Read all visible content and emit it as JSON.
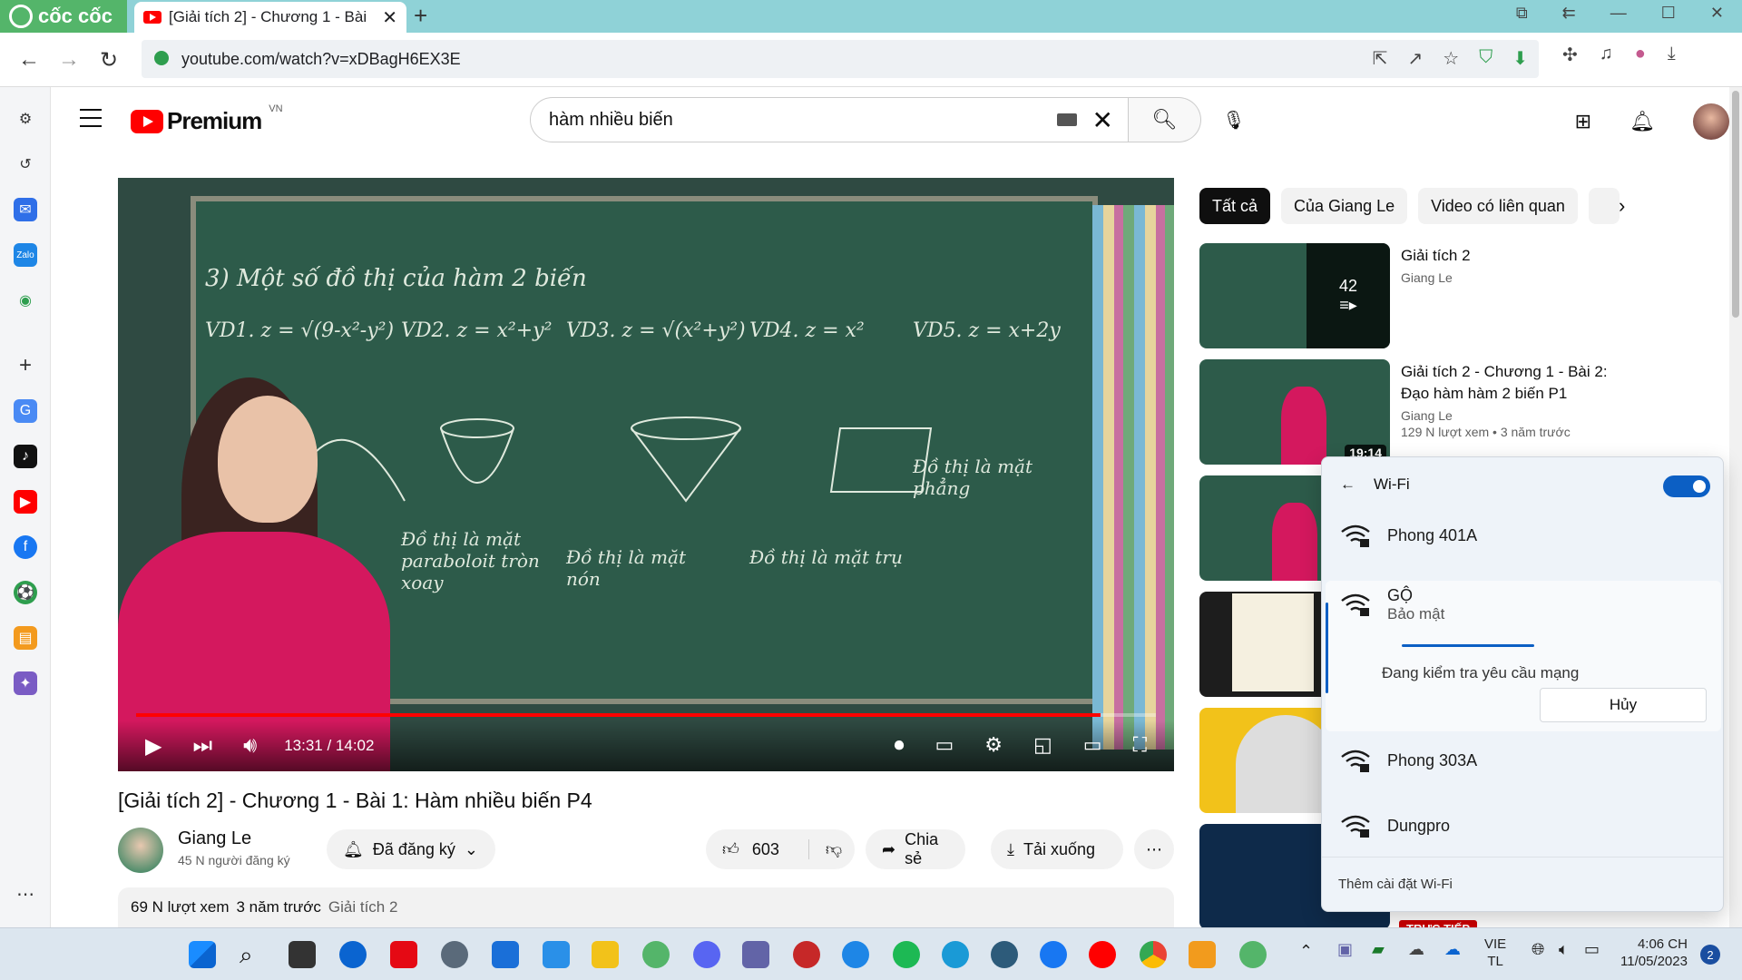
{
  "browser": {
    "brand": "cốc cốc",
    "tab_title": "[Giải tích 2] - Chương 1 - Bài",
    "tab_close": "✕",
    "new_tab": "+",
    "url": "youtube.com/watch?v=xDBagH6EX3E"
  },
  "youtube": {
    "logo_word": "Premium",
    "region": "VN",
    "search_query": "hàm nhiều biến",
    "clear": "✕"
  },
  "player": {
    "progress": 0.946,
    "time": "13:31 / 14:02",
    "board": {
      "heading": "3) Một số đồ thị của hàm 2 biến",
      "vd1": "VD1. z = √(9-x²-y²)",
      "vd2": "VD2. z = x²+y²",
      "vd3": "VD3. z = √(x²+y²)",
      "vd4": "VD4. z = x²",
      "vd5": "VD5. z = x+2y",
      "c1": "Đồ thị là mặt paraboloit tròn xoay",
      "c2": "Đồ thị là mặt nón",
      "c3": "Đồ thị là mặt trụ",
      "c4": "Đồ thị là mặt phẳng"
    }
  },
  "video": {
    "title": "[Giải tích 2] - Chương 1 - Bài 1: Hàm nhiều biến P4",
    "channel": "Giang Le",
    "subscribers": "45 N người đăng ký",
    "subscribed_label": "Đã đăng ký",
    "likes": "603",
    "share_label": "Chia sẻ",
    "download_label": "Tải xuống",
    "more": "⋯",
    "views": "69 N lượt xem",
    "age": "3 năm trước",
    "playlist_tag": "Giải tích 2"
  },
  "chips": [
    "Tất cả",
    "Của Giang Le",
    "Video có liên quan"
  ],
  "recommendations": [
    {
      "title": "Giải tích 2",
      "channel": "Giang Le",
      "badge": "42"
    },
    {
      "title": "Giải tích 2 - Chương 1 - Bài 2: Đạo hàm hàm 2 biến P1",
      "channel": "Giang Le",
      "stats": "129 N lượt xem  • 3 năm trước",
      "badge": "19:14"
    },
    {
      "title": "",
      "channel": "",
      "badge": "((•))"
    },
    {
      "title": "",
      "channel": "",
      "badge": ""
    },
    {
      "title": "",
      "channel": "",
      "badge": ""
    },
    {
      "title": "",
      "channel": "",
      "badge": "",
      "live": "TRỰC TIẾP"
    }
  ],
  "wifi": {
    "title": "Wi-Fi",
    "enabled": true,
    "networks": [
      {
        "name": "Phong 401A"
      },
      {
        "name": "GỘ",
        "status": "Bảo mật",
        "message": "Đang kiểm tra yêu cầu mạng",
        "action": "Hủy"
      },
      {
        "name": "Phong 303A"
      },
      {
        "name": "Dungpro"
      }
    ],
    "footer": "Thêm cài đặt Wi-Fi"
  },
  "taskbar": {
    "lang_top": "VIE",
    "lang_bottom": "TL",
    "time": "4:06 CH",
    "date": "11/05/2023",
    "notifications": "2"
  },
  "colors": {
    "youtube_red": "#ff0000",
    "board_green": "#2d5b4a",
    "accent_blue": "#0c5fc4",
    "coccoc_green": "#54b56a"
  }
}
